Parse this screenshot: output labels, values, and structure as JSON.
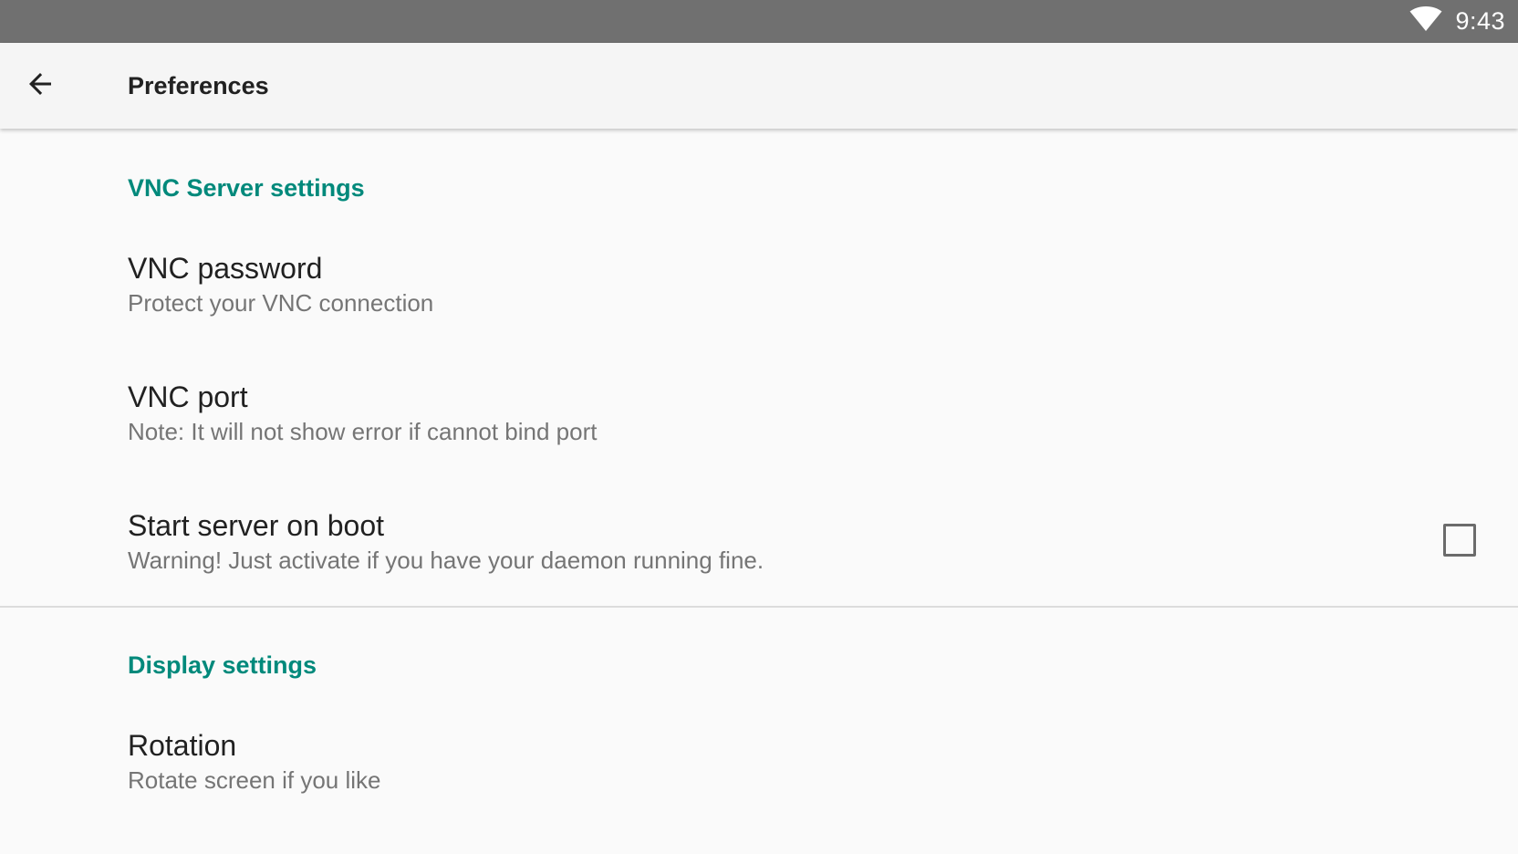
{
  "status_bar": {
    "time": "9:43",
    "icons": [
      "wifi-icon"
    ]
  },
  "toolbar": {
    "back_icon": "arrow-back-icon",
    "title": "Preferences"
  },
  "sections": [
    {
      "header": "VNC Server settings",
      "items": [
        {
          "title": "VNC password",
          "summary": "Protect your VNC connection"
        },
        {
          "title": "VNC port",
          "summary": "Note: It will not show error if cannot bind port"
        },
        {
          "title": "Start server on boot",
          "summary": "Warning! Just activate if you have your daemon running fine.",
          "checked": false
        }
      ]
    },
    {
      "header": "Display settings",
      "items": [
        {
          "title": "Rotation",
          "summary": "Rotate screen if you like"
        }
      ]
    }
  ],
  "colors": {
    "accent": "#00897b",
    "status_bar": "#707070",
    "toolbar": "#f5f5f5",
    "background": "#fafafa"
  }
}
